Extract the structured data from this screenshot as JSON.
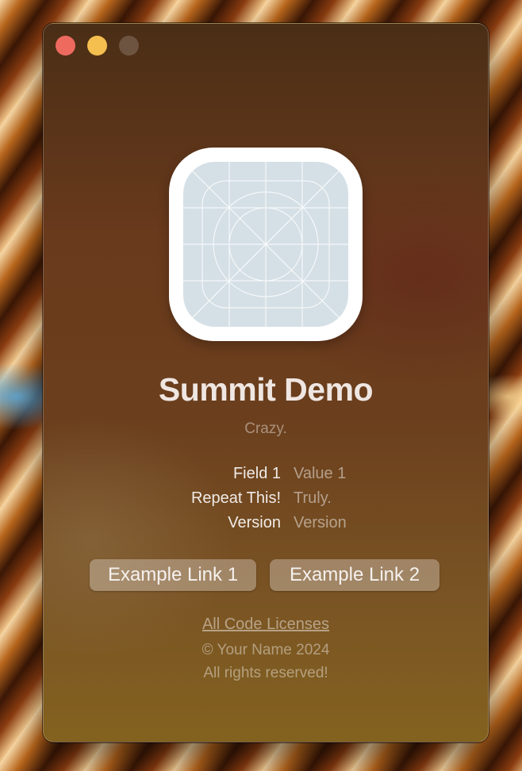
{
  "window": {
    "controls": {
      "close": "close-window-icon",
      "minimize": "minimize-window-icon",
      "zoom": "zoom-window-icon"
    },
    "colors": {
      "close": "#ee6a5f",
      "minimize": "#f5bf4f"
    }
  },
  "app": {
    "icon": "app-icon-placeholder-grid",
    "name": "Summit Demo",
    "tagline": "Crazy."
  },
  "fields": [
    {
      "key": "Field 1",
      "value": "Value 1"
    },
    {
      "key": "Repeat This!",
      "value": "Truly."
    },
    {
      "key": "Version",
      "value": "Version"
    }
  ],
  "links": [
    {
      "label": "Example Link 1"
    },
    {
      "label": "Example Link 2"
    }
  ],
  "footer": {
    "licenses_link": "All Code Licenses",
    "copyright": "© Your Name 2024",
    "rights": "All rights reserved!"
  }
}
